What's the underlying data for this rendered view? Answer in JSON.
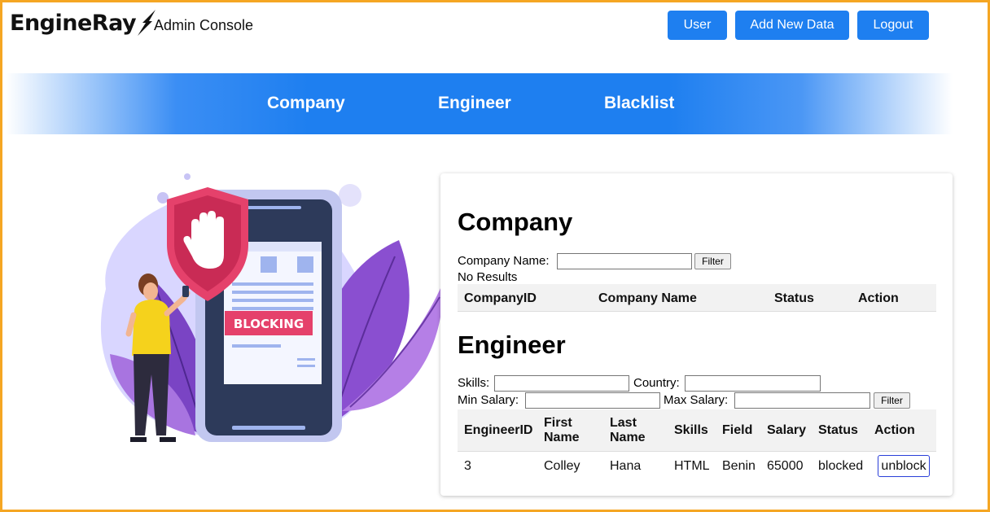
{
  "header": {
    "logo_text": "EngineRay",
    "console_title": "Admin Console",
    "buttons": {
      "user": "User",
      "add_new_data": "Add New Data",
      "logout": "Logout"
    }
  },
  "nav": {
    "company": "Company",
    "engineer": "Engineer",
    "blacklist": "Blacklist"
  },
  "illustration": {
    "badge_text": "BLOCKING"
  },
  "company_section": {
    "title": "Company",
    "filter_label": "Company Name:",
    "filter_value": "",
    "filter_button": "Filter",
    "no_results": "No Results",
    "columns": [
      "CompanyID",
      "Company Name",
      "Status",
      "Action"
    ]
  },
  "engineer_section": {
    "title": "Engineer",
    "skills_label": "Skills:",
    "country_label": "Country:",
    "min_salary_label": "Min Salary:",
    "max_salary_label": "Max Salary:",
    "skills_value": "",
    "country_value": "",
    "min_salary_value": "",
    "max_salary_value": "",
    "filter_button": "Filter",
    "columns": [
      [
        "EngineerID"
      ],
      [
        "First",
        "Name"
      ],
      [
        "Last",
        "Name"
      ],
      [
        "Skills"
      ],
      [
        "Field"
      ],
      [
        "Salary"
      ],
      [
        "Status"
      ],
      [
        "Action"
      ]
    ],
    "rows": [
      {
        "id": "3",
        "first_name": "Colley",
        "last_name": "Hana",
        "skills": "HTML",
        "field": "Benin",
        "salary": "65000",
        "status": "blocked",
        "action": "unblock"
      }
    ]
  },
  "colors": {
    "primary": "#1e7ff0",
    "frame": "#f5a623",
    "shield": "#e5416b",
    "phone": "#2d3a5a",
    "leaf": "#8a4fd0"
  }
}
